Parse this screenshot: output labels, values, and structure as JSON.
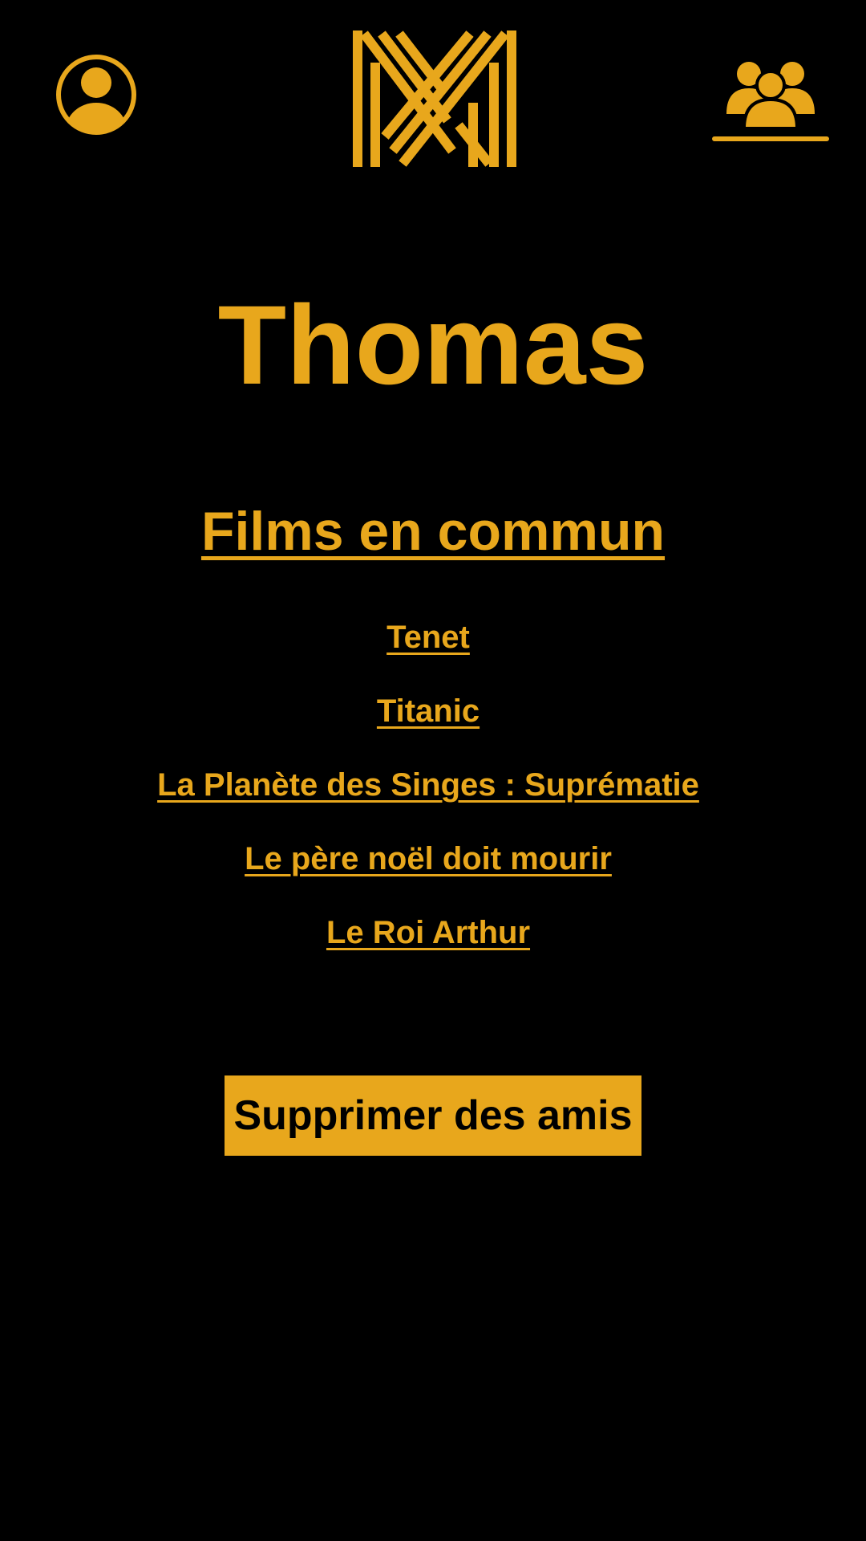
{
  "header": {
    "profile_icon": "user-circle-icon",
    "logo_icon": "m-monogram-logo",
    "friends_icon": "users-group-icon",
    "active_tab": "friends"
  },
  "friend": {
    "name": "Thomas"
  },
  "common_films": {
    "title": "Films en commun",
    "items": [
      "Tenet",
      "Titanic",
      "La Planète des Singes : Suprématie",
      "Le père noël doit mourir",
      "Le Roi Arthur"
    ]
  },
  "actions": {
    "remove_friend_label": "Supprimer des amis"
  },
  "colors": {
    "accent": "#E8A71C",
    "background": "#000000",
    "button_text": "#000000"
  }
}
